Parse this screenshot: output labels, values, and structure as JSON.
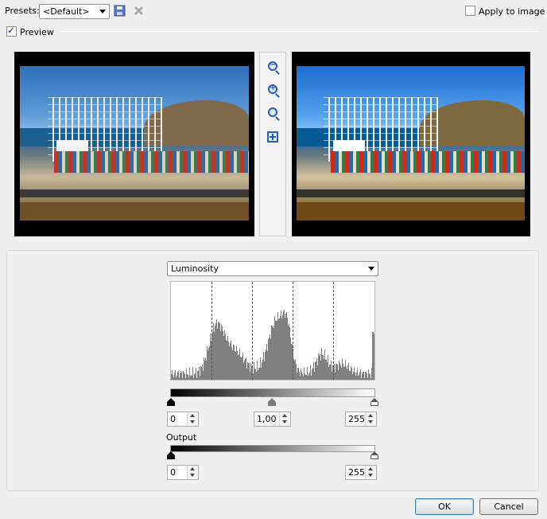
{
  "header": {
    "presets_label": "Presets:",
    "preset_value": "<Default>",
    "apply_label": "Apply to image",
    "apply_checked": false,
    "preview_label": "Preview",
    "preview_checked": true
  },
  "icons": {
    "save": "save-icon",
    "delete": "delete-icon",
    "zoom_out": "zoom-out-icon",
    "zoom_in": "zoom-in-icon",
    "actual_size": "actual-size-icon",
    "fit": "fit-to-window-icon"
  },
  "levels": {
    "channel": "Luminosity",
    "input_black": "0",
    "input_gamma": "1,00",
    "input_white": "255",
    "output_label": "Output",
    "output_black": "0",
    "output_white": "255"
  },
  "buttons": {
    "ok": "OK",
    "cancel": "Cancel"
  },
  "colors": {
    "accent": "#2a5fa8",
    "histogram": "#808080"
  }
}
